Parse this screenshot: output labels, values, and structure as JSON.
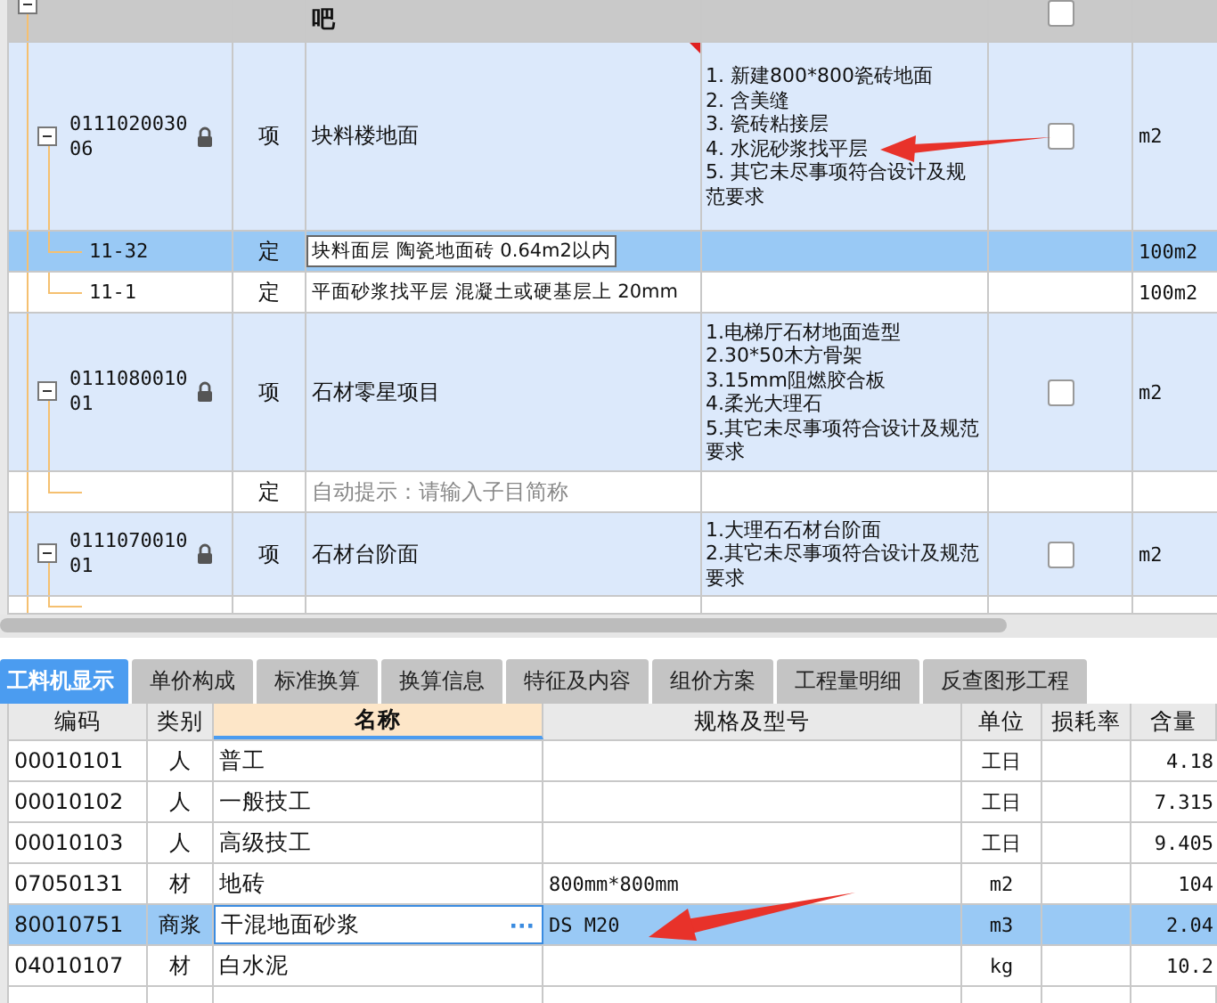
{
  "bill_rows": [
    {
      "kind": "partial_group",
      "expanded": true,
      "name": "吧",
      "checked": false
    },
    {
      "kind": "item",
      "code": "011102003006",
      "expanded": true,
      "locked": true,
      "type": "项",
      "name": "块料楼地面",
      "commented": true,
      "features": [
        "1. 新建800*800瓷砖地面",
        "2. 含美缝",
        "3. 瓷砖粘接层",
        "4. 水泥砂浆找平层",
        "5. 其它未尽事项符合设计及规范要求"
      ],
      "checked": false,
      "unit": "m2",
      "selected": false
    },
    {
      "kind": "quota",
      "code": "11-32",
      "type": "定",
      "name": "块料面层 陶瓷地面砖 0.64m2以内",
      "unit": "100m2",
      "selected": true,
      "editing": true
    },
    {
      "kind": "quota",
      "code": "11-1",
      "type": "定",
      "name": "平面砂浆找平层 混凝土或硬基层上 20mm",
      "unit": "100m2",
      "selected": false,
      "editing": false
    },
    {
      "kind": "item",
      "code": "011108001001",
      "expanded": true,
      "locked": true,
      "type": "项",
      "name": "石材零星项目",
      "commented": false,
      "features": [
        "1.电梯厅石材地面造型",
        "2.30*50木方骨架",
        "3.15mm阻燃胶合板",
        "4.柔光大理石",
        "5.其它未尽事项符合设计及规范要求"
      ],
      "checked": false,
      "unit": "m2",
      "selected": false
    },
    {
      "kind": "hint",
      "type": "定",
      "hint": "自动提示：请输入子目简称"
    },
    {
      "kind": "item",
      "code": "011107001001",
      "expanded": true,
      "locked": true,
      "type": "项",
      "name": "石材台阶面",
      "commented": false,
      "features": [
        "1.大理石石材台阶面",
        "2.其它未尽事项符合设计及规范要求"
      ],
      "checked": false,
      "unit": "m2",
      "selected": false
    },
    {
      "kind": "cut"
    }
  ],
  "tabs": [
    {
      "label": "工料机显示",
      "selected": true
    },
    {
      "label": "单价构成",
      "selected": false
    },
    {
      "label": "标准换算",
      "selected": false
    },
    {
      "label": "换算信息",
      "selected": false
    },
    {
      "label": "特征及内容",
      "selected": false
    },
    {
      "label": "组价方案",
      "selected": false
    },
    {
      "label": "工程量明细",
      "selected": false
    },
    {
      "label": "反查图形工程",
      "selected": false
    }
  ],
  "resource_table": {
    "columns": [
      {
        "label": "编码",
        "selected": false
      },
      {
        "label": "类别",
        "selected": false
      },
      {
        "label": "名称",
        "selected": true
      },
      {
        "label": "规格及型号",
        "selected": false
      },
      {
        "label": "单位",
        "selected": false
      },
      {
        "label": "损耗率",
        "selected": false
      },
      {
        "label": "含量",
        "selected": false
      }
    ],
    "rows": [
      {
        "code": "00010101",
        "category": "人",
        "name": "普工",
        "unit": "工日",
        "amount": "4.18",
        "selected": false
      },
      {
        "code": "00010102",
        "category": "人",
        "name": "一般技工",
        "unit": "工日",
        "amount": "7.315",
        "selected": false
      },
      {
        "code": "00010103",
        "category": "人",
        "name": "高级技工",
        "unit": "工日",
        "amount": "9.405",
        "selected": false
      },
      {
        "code": "07050131",
        "category": "材",
        "name": "地砖",
        "spec": "800mm*800mm",
        "unit": "m2",
        "amount": "104",
        "selected": false
      },
      {
        "code": "80010751",
        "category": "商浆",
        "name": "干混地面砂浆",
        "spec": "DS M20",
        "unit": "m3",
        "amount": "2.04",
        "selected": true,
        "more_button": "···"
      },
      {
        "code": "04010107",
        "category": "材",
        "name": "白水泥",
        "unit": "kg",
        "amount": "10.2",
        "selected": false
      }
    ]
  }
}
